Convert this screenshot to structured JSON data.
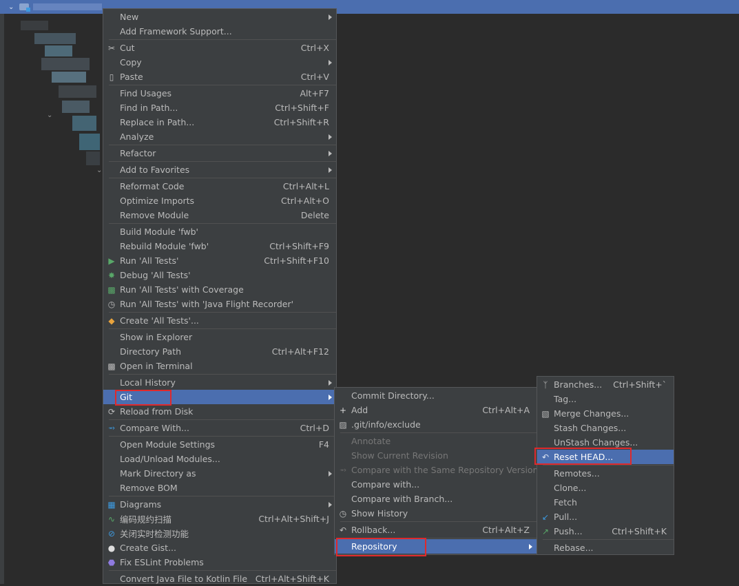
{
  "colors": {
    "accent": "#4b6eaf",
    "menu_bg": "#3c3f41",
    "text": "#bbbbbb",
    "highlight_box": "#e0292b"
  },
  "main_menu": [
    {
      "type": "item",
      "label": "New",
      "shortcut": "",
      "submenu": true,
      "icon": ""
    },
    {
      "type": "item",
      "label": "Add Framework Support...",
      "shortcut": "",
      "submenu": false,
      "icon": ""
    },
    {
      "type": "sep"
    },
    {
      "type": "item",
      "label": "Cut",
      "shortcut": "Ctrl+X",
      "submenu": false,
      "icon": "scissors-icon"
    },
    {
      "type": "item",
      "label": "Copy",
      "shortcut": "",
      "submenu": true,
      "icon": ""
    },
    {
      "type": "item",
      "label": "Paste",
      "shortcut": "Ctrl+V",
      "submenu": false,
      "icon": "clipboard-icon"
    },
    {
      "type": "sep"
    },
    {
      "type": "item",
      "label": "Find Usages",
      "shortcut": "Alt+F7",
      "submenu": false,
      "icon": ""
    },
    {
      "type": "item",
      "label": "Find in Path...",
      "shortcut": "Ctrl+Shift+F",
      "submenu": false,
      "icon": ""
    },
    {
      "type": "item",
      "label": "Replace in Path...",
      "shortcut": "Ctrl+Shift+R",
      "submenu": false,
      "icon": ""
    },
    {
      "type": "item",
      "label": "Analyze",
      "shortcut": "",
      "submenu": true,
      "icon": ""
    },
    {
      "type": "sep"
    },
    {
      "type": "item",
      "label": "Refactor",
      "shortcut": "",
      "submenu": true,
      "icon": ""
    },
    {
      "type": "sep"
    },
    {
      "type": "item",
      "label": "Add to Favorites",
      "shortcut": "",
      "submenu": true,
      "icon": ""
    },
    {
      "type": "sep"
    },
    {
      "type": "item",
      "label": "Reformat Code",
      "shortcut": "Ctrl+Alt+L",
      "submenu": false,
      "icon": ""
    },
    {
      "type": "item",
      "label": "Optimize Imports",
      "shortcut": "Ctrl+Alt+O",
      "submenu": false,
      "icon": ""
    },
    {
      "type": "item",
      "label": "Remove Module",
      "shortcut": "Delete",
      "submenu": false,
      "icon": ""
    },
    {
      "type": "sep"
    },
    {
      "type": "item",
      "label": "Build Module 'fwb'",
      "shortcut": "",
      "submenu": false,
      "icon": ""
    },
    {
      "type": "item",
      "label": "Rebuild Module 'fwb'",
      "shortcut": "Ctrl+Shift+F9",
      "submenu": false,
      "icon": ""
    },
    {
      "type": "item",
      "label": "Run 'All Tests'",
      "shortcut": "Ctrl+Shift+F10",
      "submenu": false,
      "icon": "run-icon"
    },
    {
      "type": "item",
      "label": "Debug 'All Tests'",
      "shortcut": "",
      "submenu": false,
      "icon": "debug-icon"
    },
    {
      "type": "item",
      "label": "Run 'All Tests' with Coverage",
      "shortcut": "",
      "submenu": false,
      "icon": "coverage-icon"
    },
    {
      "type": "item",
      "label": "Run 'All Tests' with 'Java Flight Recorder'",
      "shortcut": "",
      "submenu": false,
      "icon": "flight-recorder-icon"
    },
    {
      "type": "sep"
    },
    {
      "type": "item",
      "label": "Create 'All Tests'...",
      "shortcut": "",
      "submenu": false,
      "icon": "create-test-icon"
    },
    {
      "type": "sep"
    },
    {
      "type": "item",
      "label": "Show in Explorer",
      "shortcut": "",
      "submenu": false,
      "icon": ""
    },
    {
      "type": "item",
      "label": "Directory Path",
      "shortcut": "Ctrl+Alt+F12",
      "submenu": false,
      "icon": ""
    },
    {
      "type": "item",
      "label": "Open in Terminal",
      "shortcut": "",
      "submenu": false,
      "icon": "terminal-icon"
    },
    {
      "type": "sep"
    },
    {
      "type": "item",
      "label": "Local History",
      "shortcut": "",
      "submenu": true,
      "icon": ""
    },
    {
      "type": "item",
      "label": "Git",
      "shortcut": "",
      "submenu": true,
      "icon": "",
      "selected": true
    },
    {
      "type": "item",
      "label": "Reload from Disk",
      "shortcut": "",
      "submenu": false,
      "icon": "reload-icon"
    },
    {
      "type": "sep"
    },
    {
      "type": "item",
      "label": "Compare With...",
      "shortcut": "Ctrl+D",
      "submenu": false,
      "icon": "compare-icon"
    },
    {
      "type": "sep"
    },
    {
      "type": "item",
      "label": "Open Module Settings",
      "shortcut": "F4",
      "submenu": false,
      "icon": ""
    },
    {
      "type": "item",
      "label": "Load/Unload Modules...",
      "shortcut": "",
      "submenu": false,
      "icon": ""
    },
    {
      "type": "item",
      "label": "Mark Directory as",
      "shortcut": "",
      "submenu": true,
      "icon": ""
    },
    {
      "type": "item",
      "label": "Remove BOM",
      "shortcut": "",
      "submenu": false,
      "icon": ""
    },
    {
      "type": "sep"
    },
    {
      "type": "item",
      "label": "Diagrams",
      "shortcut": "",
      "submenu": true,
      "icon": "diagram-icon"
    },
    {
      "type": "item",
      "label": "编码规约扫描",
      "shortcut": "Ctrl+Alt+Shift+J",
      "submenu": false,
      "icon": "code-scan-icon"
    },
    {
      "type": "item",
      "label": "关闭实时检测功能",
      "shortcut": "",
      "submenu": false,
      "icon": "no-entry-icon"
    },
    {
      "type": "item",
      "label": "Create Gist...",
      "shortcut": "",
      "submenu": false,
      "icon": "github-icon"
    },
    {
      "type": "item",
      "label": "Fix ESLint Problems",
      "shortcut": "",
      "submenu": false,
      "icon": "eslint-icon"
    },
    {
      "type": "sep"
    },
    {
      "type": "item",
      "label": "Convert Java File to Kotlin File",
      "shortcut": "Ctrl+Alt+Shift+K",
      "submenu": false,
      "icon": ""
    }
  ],
  "git_menu": [
    {
      "type": "item",
      "label": "Commit Directory...",
      "shortcut": "",
      "submenu": false,
      "icon": ""
    },
    {
      "type": "item",
      "label": "Add",
      "shortcut": "Ctrl+Alt+A",
      "submenu": false,
      "icon": "plus-icon"
    },
    {
      "type": "item",
      "label": ".git/info/exclude",
      "shortcut": "",
      "submenu": false,
      "icon": "git-file-icon"
    },
    {
      "type": "sep"
    },
    {
      "type": "item",
      "label": "Annotate",
      "shortcut": "",
      "submenu": false,
      "icon": "",
      "disabled": true
    },
    {
      "type": "item",
      "label": "Show Current Revision",
      "shortcut": "",
      "submenu": false,
      "icon": "",
      "disabled": true
    },
    {
      "type": "item",
      "label": "Compare with the Same Repository Version",
      "shortcut": "",
      "submenu": false,
      "icon": "compare-icon",
      "disabled": true
    },
    {
      "type": "item",
      "label": "Compare with...",
      "shortcut": "",
      "submenu": false,
      "icon": ""
    },
    {
      "type": "item",
      "label": "Compare with Branch...",
      "shortcut": "",
      "submenu": false,
      "icon": ""
    },
    {
      "type": "item",
      "label": "Show History",
      "shortcut": "",
      "submenu": false,
      "icon": "clock-icon"
    },
    {
      "type": "sep"
    },
    {
      "type": "item",
      "label": "Rollback...",
      "shortcut": "Ctrl+Alt+Z",
      "submenu": false,
      "icon": "undo-icon"
    },
    {
      "type": "sep"
    },
    {
      "type": "item",
      "label": "Repository",
      "shortcut": "",
      "submenu": true,
      "icon": "",
      "selected": true
    }
  ],
  "repo_menu": [
    {
      "type": "item",
      "label": "Branches...",
      "shortcut": "Ctrl+Shift+`",
      "submenu": false,
      "icon": "branch-icon"
    },
    {
      "type": "item",
      "label": "Tag...",
      "shortcut": "",
      "submenu": false,
      "icon": ""
    },
    {
      "type": "item",
      "label": "Merge Changes...",
      "shortcut": "",
      "submenu": false,
      "icon": "merge-icon"
    },
    {
      "type": "item",
      "label": "Stash Changes...",
      "shortcut": "",
      "submenu": false,
      "icon": ""
    },
    {
      "type": "item",
      "label": "UnStash Changes...",
      "shortcut": "",
      "submenu": false,
      "icon": ""
    },
    {
      "type": "item",
      "label": "Reset HEAD...",
      "shortcut": "",
      "submenu": false,
      "icon": "reset-icon",
      "selected": true
    },
    {
      "type": "sep"
    },
    {
      "type": "item",
      "label": "Remotes...",
      "shortcut": "",
      "submenu": false,
      "icon": ""
    },
    {
      "type": "item",
      "label": "Clone...",
      "shortcut": "",
      "submenu": false,
      "icon": ""
    },
    {
      "type": "item",
      "label": "Fetch",
      "shortcut": "",
      "submenu": false,
      "icon": ""
    },
    {
      "type": "item",
      "label": "Pull...",
      "shortcut": "",
      "submenu": false,
      "icon": "pull-icon"
    },
    {
      "type": "item",
      "label": "Push...",
      "shortcut": "Ctrl+Shift+K",
      "submenu": false,
      "icon": "push-icon"
    },
    {
      "type": "sep"
    },
    {
      "type": "item",
      "label": "Rebase...",
      "shortcut": "",
      "submenu": false,
      "icon": ""
    }
  ]
}
